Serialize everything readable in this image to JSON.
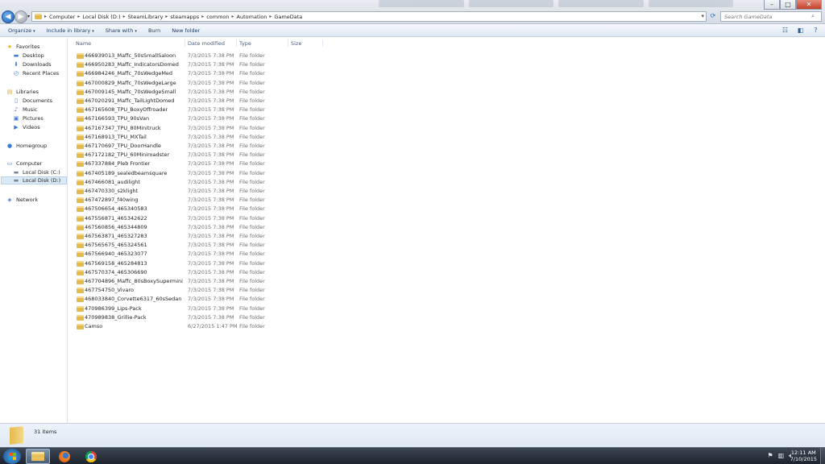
{
  "window": {
    "breadcrumbs": [
      "Computer",
      "Local Disk (D:)",
      "SteamLibrary",
      "steamapps",
      "common",
      "Automation",
      "GameData"
    ],
    "search_placeholder": "Search GameData",
    "controls": {
      "minimize": "–",
      "maximize": "□",
      "close": "✕"
    }
  },
  "toolbar": {
    "organize": "Organize",
    "include_in_library": "Include in library",
    "share_with": "Share with",
    "burn": "Burn",
    "new_folder": "New folder"
  },
  "nav": {
    "favorites": "Favorites",
    "desktop": "Desktop",
    "downloads": "Downloads",
    "recent_places": "Recent Places",
    "libraries": "Libraries",
    "documents": "Documents",
    "music": "Music",
    "pictures": "Pictures",
    "videos": "Videos",
    "homegroup": "Homegroup",
    "computer": "Computer",
    "local_disk_c": "Local Disk (C:)",
    "local_disk_d": "Local Disk (D:)",
    "network": "Network"
  },
  "columns": {
    "name": "Name",
    "date_modified": "Date modified",
    "type": "Type",
    "size": "Size"
  },
  "files": [
    {
      "name": "466939013_Maffc_50sSmallSaloon",
      "date": "7/3/2015 7:38 PM",
      "type": "File folder"
    },
    {
      "name": "466950283_Maffc_IndicatorsDomed",
      "date": "7/3/2015 7:38 PM",
      "type": "File folder"
    },
    {
      "name": "466984246_Maffc_70sWedgeMed",
      "date": "7/3/2015 7:38 PM",
      "type": "File folder"
    },
    {
      "name": "467000829_Maffc_70sWedgeLarge",
      "date": "7/3/2015 7:38 PM",
      "type": "File folder"
    },
    {
      "name": "467009145_Maffc_70sWedgeSmall",
      "date": "7/3/2015 7:38 PM",
      "type": "File folder"
    },
    {
      "name": "467020291_Maffc_TailLightDomed",
      "date": "7/3/2015 7:38 PM",
      "type": "File folder"
    },
    {
      "name": "467165608_TPU_BoxyOffroader",
      "date": "7/3/2015 7:38 PM",
      "type": "File folder"
    },
    {
      "name": "467166593_TPU_90sVan",
      "date": "7/3/2015 7:38 PM",
      "type": "File folder"
    },
    {
      "name": "467167347_TPU_80Minitruck",
      "date": "7/3/2015 7:38 PM",
      "type": "File folder"
    },
    {
      "name": "467168913_TPU_MXTail",
      "date": "7/3/2015 7:38 PM",
      "type": "File folder"
    },
    {
      "name": "467170697_TPU_DoorHandle",
      "date": "7/3/2015 7:38 PM",
      "type": "File folder"
    },
    {
      "name": "467172182_TPU_60Miniroadster",
      "date": "7/3/2015 7:38 PM",
      "type": "File folder"
    },
    {
      "name": "467337884_Pleb Frontier",
      "date": "7/3/2015 7:38 PM",
      "type": "File folder"
    },
    {
      "name": "467405189_sealedbeamsquare",
      "date": "7/3/2015 7:38 PM",
      "type": "File folder"
    },
    {
      "name": "467466081_audilight",
      "date": "7/3/2015 7:38 PM",
      "type": "File folder"
    },
    {
      "name": "467470330_s2klight",
      "date": "7/3/2015 7:38 PM",
      "type": "File folder"
    },
    {
      "name": "467472897_f40wing",
      "date": "7/3/2015 7:38 PM",
      "type": "File folder"
    },
    {
      "name": "467506654_465340583",
      "date": "7/3/2015 7:38 PM",
      "type": "File folder"
    },
    {
      "name": "467556871_465342622",
      "date": "7/3/2015 7:38 PM",
      "type": "File folder"
    },
    {
      "name": "467560856_465344809",
      "date": "7/3/2015 7:38 PM",
      "type": "File folder"
    },
    {
      "name": "467563871_465327283",
      "date": "7/3/2015 7:38 PM",
      "type": "File folder"
    },
    {
      "name": "467565675_465324561",
      "date": "7/3/2015 7:38 PM",
      "type": "File folder"
    },
    {
      "name": "467566940_465323077",
      "date": "7/3/2015 7:38 PM",
      "type": "File folder"
    },
    {
      "name": "467569158_465284813",
      "date": "7/3/2015 7:38 PM",
      "type": "File folder"
    },
    {
      "name": "467570374_465306690",
      "date": "7/3/2015 7:38 PM",
      "type": "File folder"
    },
    {
      "name": "467704896_Maffc_80sBoxySupermini",
      "date": "7/3/2015 7:38 PM",
      "type": "File folder"
    },
    {
      "name": "467754750_Vivaro",
      "date": "7/3/2015 7:38 PM",
      "type": "File folder"
    },
    {
      "name": "468033840_Corvette6317_60sSedan",
      "date": "7/3/2015 7:38 PM",
      "type": "File folder"
    },
    {
      "name": "470986399_Lips-Pack",
      "date": "7/3/2015 7:38 PM",
      "type": "File folder"
    },
    {
      "name": "470989838_Grillie-Pack",
      "date": "7/3/2015 7:38 PM",
      "type": "File folder"
    },
    {
      "name": "Camso",
      "date": "6/27/2015 1:47 PM",
      "type": "File folder"
    }
  ],
  "status": {
    "item_count": "31 items"
  },
  "taskbar": {
    "time": "12:11 AM",
    "date": "7/10/2015"
  }
}
